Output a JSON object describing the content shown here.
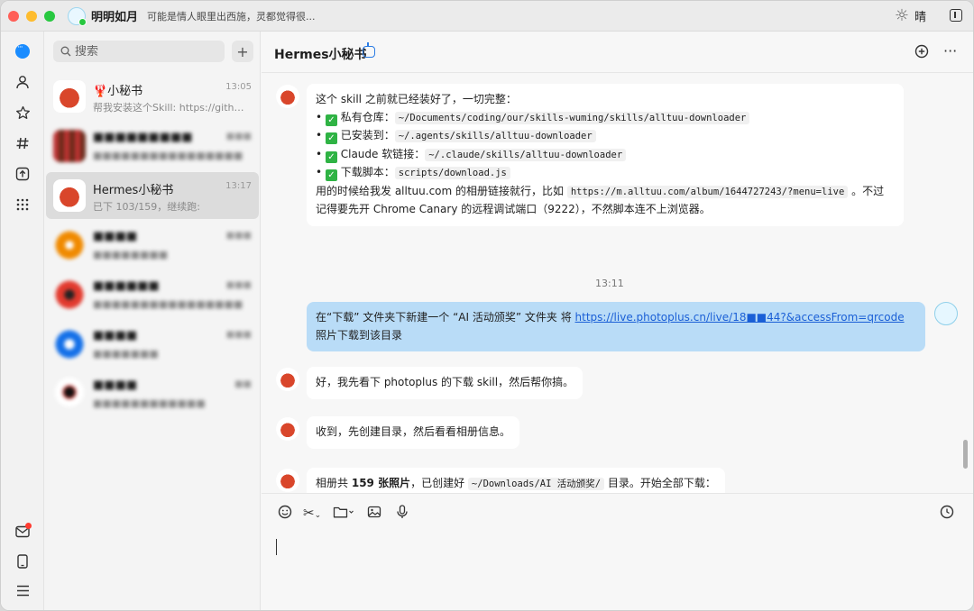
{
  "titlebar": {
    "user_name": "明明如月",
    "status": "可能是情人眼里出西施，灵都觉得很...",
    "weather_icon": "sun-icon",
    "weather_text": "晴"
  },
  "nav": {
    "icons": [
      "chat-icon",
      "contacts-icon",
      "favorites-icon",
      "channels-icon",
      "upload-icon",
      "apps-icon",
      "mail-icon",
      "phone-icon",
      "menu-icon"
    ]
  },
  "search": {
    "placeholder": "搜索"
  },
  "conversations": [
    {
      "name": "🦞小秘书",
      "preview": "帮我安装这个Skill: https://github.c...",
      "time": "13:05"
    },
    {
      "name": "",
      "preview": "",
      "time": ""
    },
    {
      "name": "Hermes小秘书",
      "preview": "已下 103/159，继续跑:",
      "time": "13:17"
    },
    {
      "name": "",
      "preview": "",
      "time": ""
    },
    {
      "name": "",
      "preview": "",
      "time": ""
    },
    {
      "name": "",
      "preview": "",
      "time": ""
    },
    {
      "name": "",
      "preview": "",
      "time": ""
    }
  ],
  "chat": {
    "title": "Hermes小秘书",
    "messages": {
      "m1_intro": "这个 skill 之前就已经装好了，一切完整：",
      "m1_items": [
        {
          "label": "私有仓库：",
          "code": "~/Documents/coding/our/skills-wuming/skills/alltuu-downloader"
        },
        {
          "label": "已安装到：",
          "code": "~/.agents/skills/alltuu-downloader"
        },
        {
          "label": "Claude 软链接：",
          "code": "~/.claude/skills/alltuu-downloader"
        },
        {
          "label": "下载脚本：",
          "code": "scripts/download.js"
        }
      ],
      "m1_outro_a": "用的时候给我发 alltuu.com 的相册链接就行，比如",
      "m1_outro_code": "https://m.alltuu.com/album/1644727243/?menu=live",
      "m1_outro_b": "。不过记得要先开 Chrome Canary 的远程调试端口（9222），不然脚本连不上浏览器。",
      "time": "13:11",
      "m2_a": "在“下载” 文件夹下新建一个 “AI 活动颁奖” 文件夹 将",
      "m2_link": "https://live.photoplus.cn/live/18■■44?&accessFrom=qrcode",
      "m2_b": "照片下载到该目录",
      "m3": "好，我先看下 photoplus 的下载 skill，然后帮你搞。",
      "m4": "收到，先创建目录，然后看看相册信息。",
      "m5_a": "相册共",
      "m5_bold": "159 张照片",
      "m5_b": "，已创建好",
      "m5_code": "~/Downloads/AI 活动颁奖/",
      "m5_c": "目录。开始全部下载："
    }
  }
}
